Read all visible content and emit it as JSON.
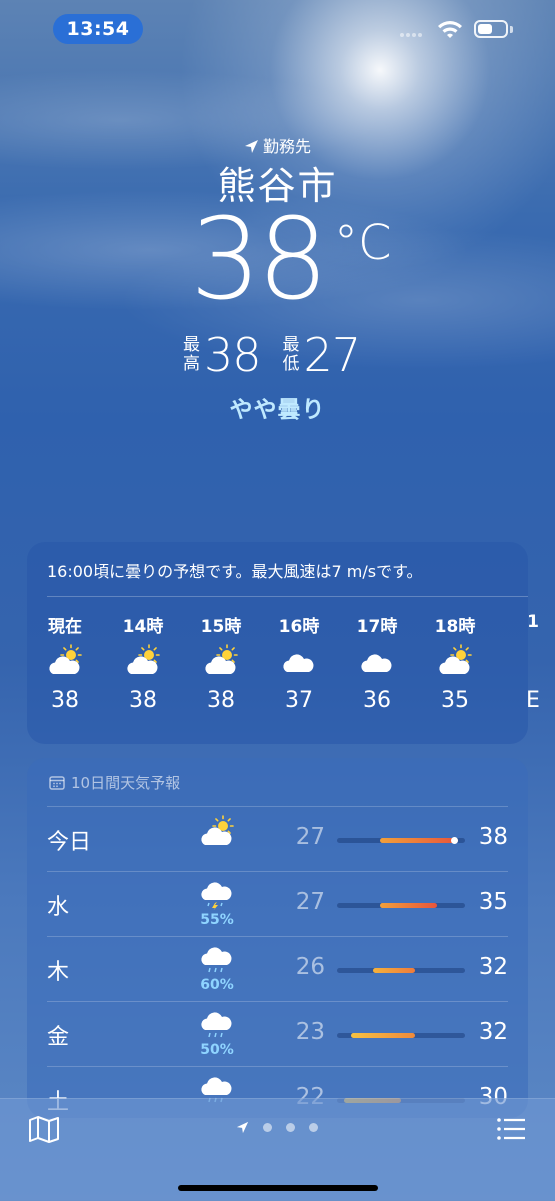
{
  "status": {
    "time": "13:54",
    "battery_level": 0.55
  },
  "header": {
    "location_label": "勤務先",
    "city": "熊谷市",
    "temperature": "38",
    "unit": "°C",
    "high_label_1": "最",
    "high_label_2": "高",
    "high": "38",
    "low_label_1": "最",
    "low_label_2": "低",
    "low": "27",
    "condition": "やや曇り"
  },
  "hourly": {
    "summary": "16:00頃に曇りの予想です。最大風速は7 m/sです。",
    "items": [
      {
        "label": "現在",
        "icon": "partly-sunny-icon",
        "temp": "38"
      },
      {
        "label": "14時",
        "icon": "partly-sunny-icon",
        "temp": "38"
      },
      {
        "label": "15時",
        "icon": "partly-sunny-icon",
        "temp": "38"
      },
      {
        "label": "16時",
        "icon": "cloud-icon",
        "temp": "37"
      },
      {
        "label": "17時",
        "icon": "cloud-icon",
        "temp": "36"
      },
      {
        "label": "18時",
        "icon": "partly-sunny-icon",
        "temp": "35"
      },
      {
        "label": "1",
        "icon": "",
        "temp": "E"
      }
    ]
  },
  "daily": {
    "title": "10日間天気予報",
    "range_min": 21,
    "range_max": 39,
    "days": [
      {
        "day": "今日",
        "icon": "partly-sunny-icon",
        "pop": "",
        "low": "27",
        "high": "38",
        "current": 37.5,
        "color_from": "#f2a03a",
        "color_to": "#e8553b"
      },
      {
        "day": "水",
        "icon": "thunderstorm-icon",
        "pop": "55%",
        "low": "27",
        "high": "35",
        "color_from": "#f2a03a",
        "color_to": "#e8553b"
      },
      {
        "day": "木",
        "icon": "rain-cloud-icon",
        "pop": "60%",
        "low": "26",
        "high": "32",
        "color_from": "#f5b23c",
        "color_to": "#ef7b3b"
      },
      {
        "day": "金",
        "icon": "rain-cloud-icon",
        "pop": "50%",
        "low": "23",
        "high": "32",
        "color_from": "#f7c243",
        "color_to": "#ef8a3b"
      },
      {
        "day": "土",
        "icon": "rain-cloud-icon",
        "pop": "",
        "low": "22",
        "high": "30",
        "color_from": "#f7c243",
        "color_to": "#f0993b"
      }
    ]
  },
  "tabbar": {
    "page_count": 3
  }
}
